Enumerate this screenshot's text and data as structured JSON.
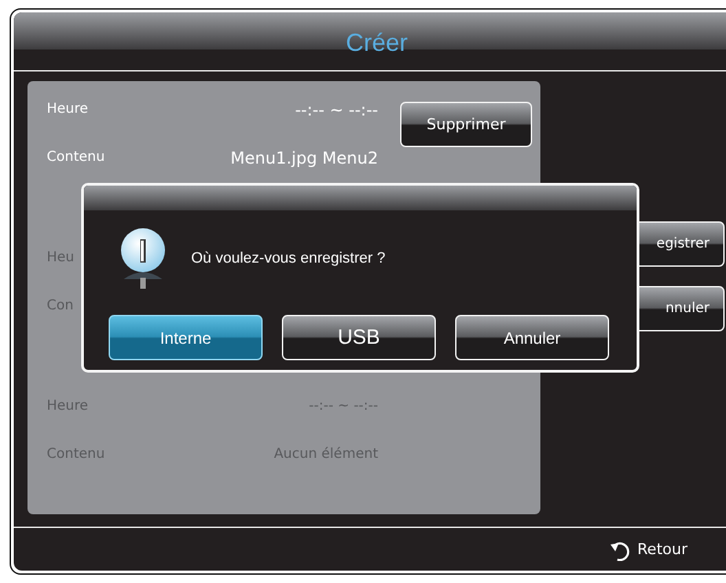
{
  "window": {
    "title": "Créer"
  },
  "schedules": [
    {
      "disabled": false,
      "rows": [
        {
          "label": "Heure",
          "value": "--:-- ~ --:--"
        },
        {
          "label": "Contenu",
          "value": "Menu1.jpg Menu2"
        }
      ],
      "button": "Supprimer"
    },
    {
      "disabled": true,
      "rows": [
        {
          "label": "Heu"
        },
        {
          "label": "Con"
        }
      ]
    },
    {
      "disabled": true,
      "rows": [
        {
          "label": "Heure",
          "value": "--:-- ~ --:--"
        },
        {
          "label": "Contenu",
          "value": "Aucun élément"
        }
      ]
    }
  ],
  "side_buttons": [
    "egistrer",
    "nnuler"
  ],
  "dialog": {
    "message": "Où voulez-vous enregistrer ?",
    "buttons": [
      {
        "label": "Interne",
        "selected": true
      },
      {
        "label": "USB",
        "selected": false
      },
      {
        "label": "Annuler",
        "selected": false
      }
    ]
  },
  "footer": {
    "back": "Retour"
  }
}
